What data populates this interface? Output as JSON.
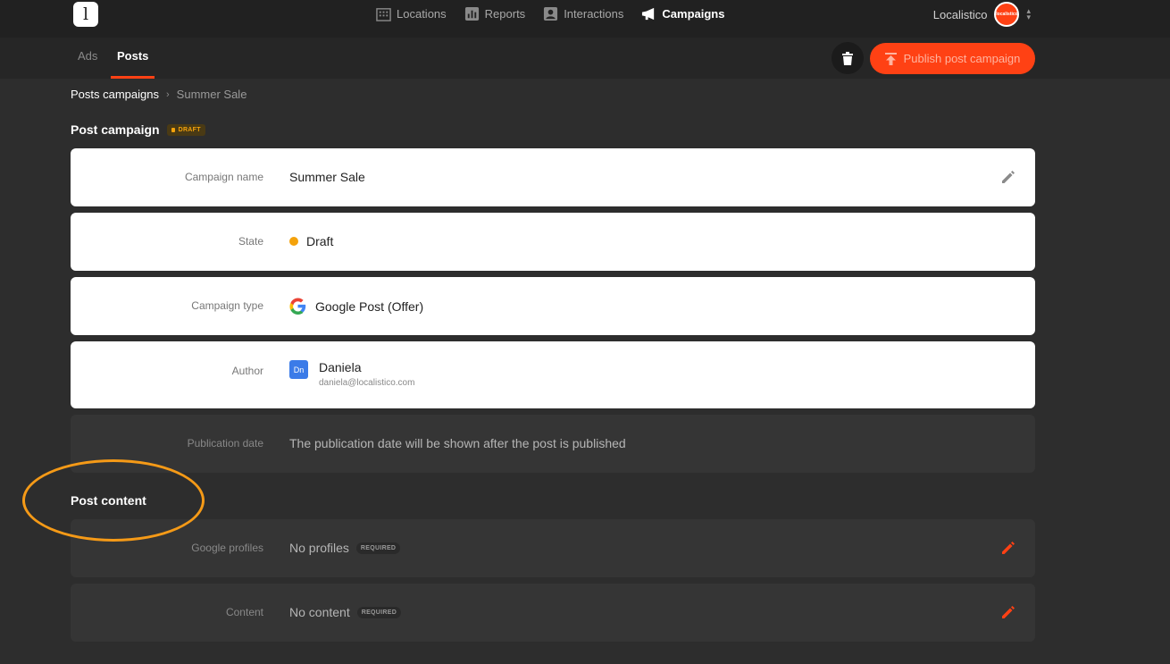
{
  "app": {
    "logo_letter": "l"
  },
  "topnav": {
    "items": [
      {
        "label": "Locations",
        "icon": "building-icon",
        "active": false
      },
      {
        "label": "Reports",
        "icon": "bar-chart-icon",
        "active": false
      },
      {
        "label": "Interactions",
        "icon": "person-card-icon",
        "active": false
      },
      {
        "label": "Campaigns",
        "icon": "megaphone-icon",
        "active": true
      }
    ]
  },
  "account": {
    "name": "Localistico",
    "avatar_text": "localistico"
  },
  "tabs": [
    {
      "label": "Ads",
      "active": false
    },
    {
      "label": "Posts",
      "active": true
    }
  ],
  "actions": {
    "publish_label": "Publish post campaign"
  },
  "breadcrumb": {
    "parent": "Posts campaigns",
    "separator": "›",
    "current": "Summer Sale"
  },
  "campaign": {
    "title": "Post campaign",
    "badge": "DRAFT",
    "fields": {
      "name": {
        "label": "Campaign name",
        "value": "Summer Sale"
      },
      "state": {
        "label": "State",
        "value": "Draft"
      },
      "type": {
        "label": "Campaign type",
        "value": "Google Post (Offer)"
      },
      "author": {
        "label": "Author",
        "initials": "Dn",
        "name": "Daniela",
        "email": "daniela@localistico.com"
      },
      "publication": {
        "label": "Publication date",
        "value": "The publication date will be shown after the post is published"
      }
    }
  },
  "content": {
    "title": "Post content",
    "fields": {
      "profiles": {
        "label": "Google profiles",
        "value": "No profiles",
        "badge": "REQUIRED"
      },
      "content": {
        "label": "Content",
        "value": "No content",
        "badge": "REQUIRED"
      }
    }
  },
  "colors": {
    "accent": "#ff4114",
    "draft": "#f4a20b",
    "highlight": "#f59a17"
  }
}
